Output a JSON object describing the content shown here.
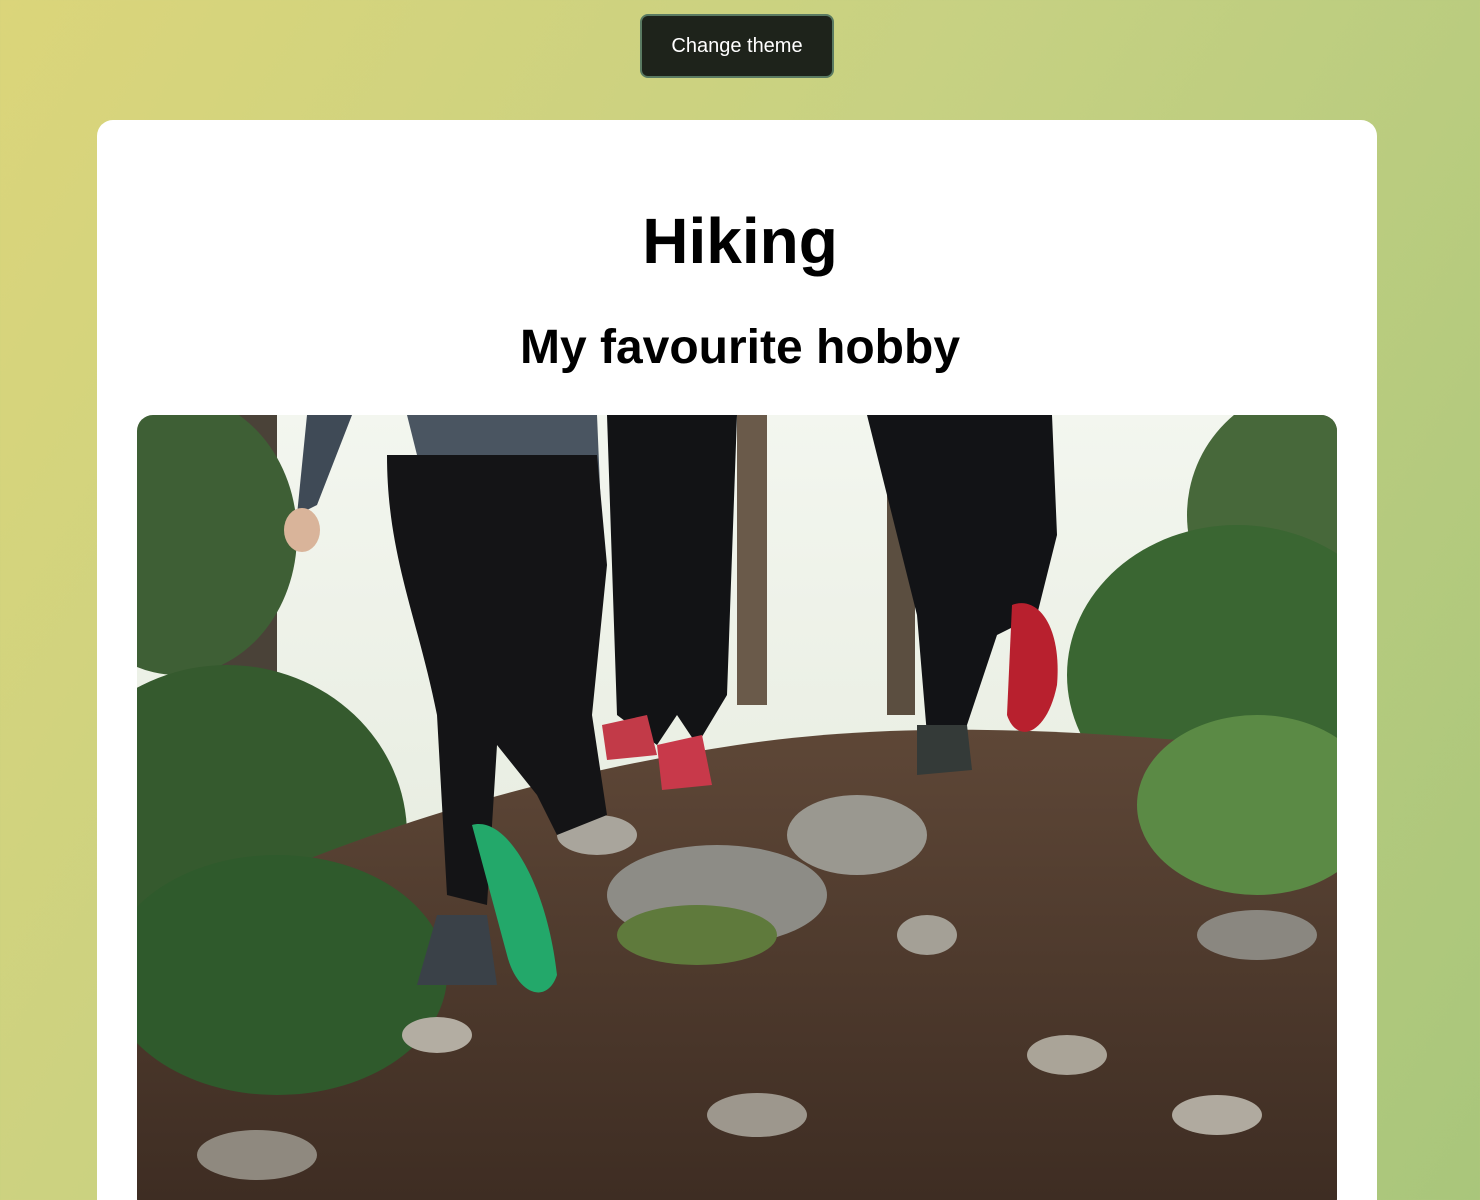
{
  "controls": {
    "theme_button_label": "Change theme"
  },
  "page": {
    "title": "Hiking",
    "subtitle": "My favourite hobby"
  },
  "photo": {
    "subject": "hikers-on-forest-trail"
  },
  "colors": {
    "button_bg": "#1e231b",
    "button_border": "#5a7a62",
    "card_bg": "#ffffff",
    "gradient_start": "#dbd57a",
    "gradient_end": "#a9c67b"
  }
}
